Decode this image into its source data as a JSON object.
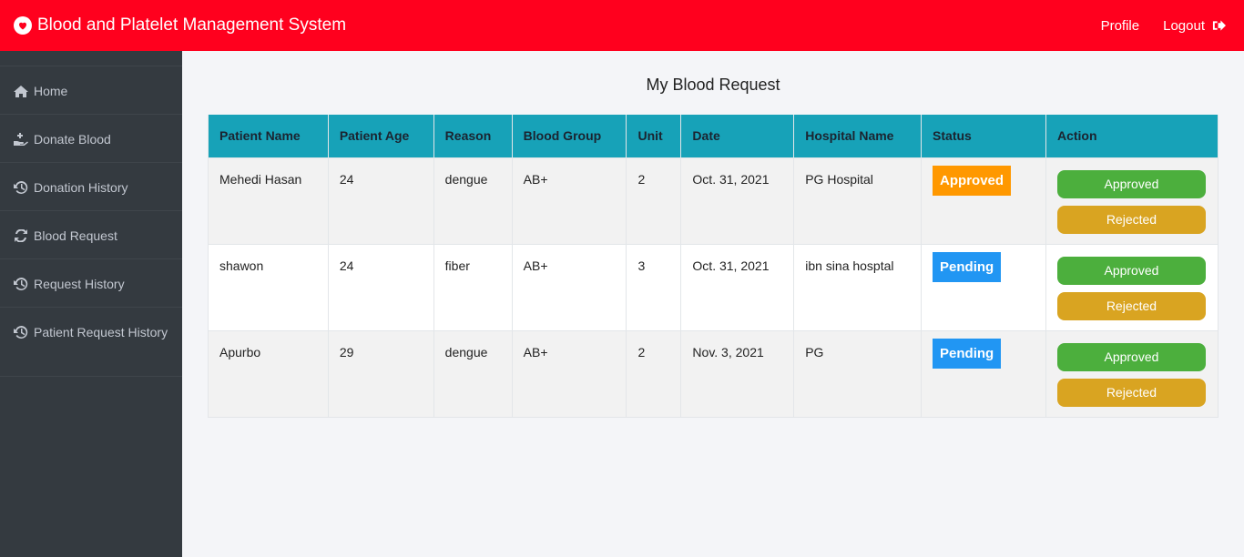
{
  "header": {
    "title": "Blood and Platelet Management System",
    "profile_label": "Profile",
    "logout_label": "Logout",
    "brand_color": "#ff001e"
  },
  "sidebar": {
    "items": [
      {
        "label": "Home",
        "icon": "home-icon"
      },
      {
        "label": "Donate Blood",
        "icon": "hand-donate-icon"
      },
      {
        "label": "Donation History",
        "icon": "history-icon"
      },
      {
        "label": "Blood Request",
        "icon": "refresh-icon"
      },
      {
        "label": "Request History",
        "icon": "history-icon"
      },
      {
        "label": "Patient Request History",
        "icon": "history-icon"
      }
    ]
  },
  "main": {
    "title": "My Blood Request",
    "columns": [
      "Patient Name",
      "Patient Age",
      "Reason",
      "Blood Group",
      "Unit",
      "Date",
      "Hospital Name",
      "Status",
      "Action"
    ],
    "rows": [
      {
        "patient_name": "Mehedi Hasan",
        "age": "24",
        "reason": "dengue",
        "blood_group": "AB+",
        "unit": "2",
        "date": "Oct. 31, 2021",
        "hospital": "PG Hospital",
        "status": "Approved"
      },
      {
        "patient_name": "shawon",
        "age": "24",
        "reason": "fiber",
        "blood_group": "AB+",
        "unit": "3",
        "date": "Oct. 31, 2021",
        "hospital": "ibn sina hosptal",
        "status": "Pending"
      },
      {
        "patient_name": "Apurbo",
        "age": "29",
        "reason": "dengue",
        "blood_group": "AB+",
        "unit": "2",
        "date": "Nov. 3, 2021",
        "hospital": "PG",
        "status": "Pending"
      }
    ],
    "approve_label": "Approved",
    "reject_label": "Rejected"
  }
}
